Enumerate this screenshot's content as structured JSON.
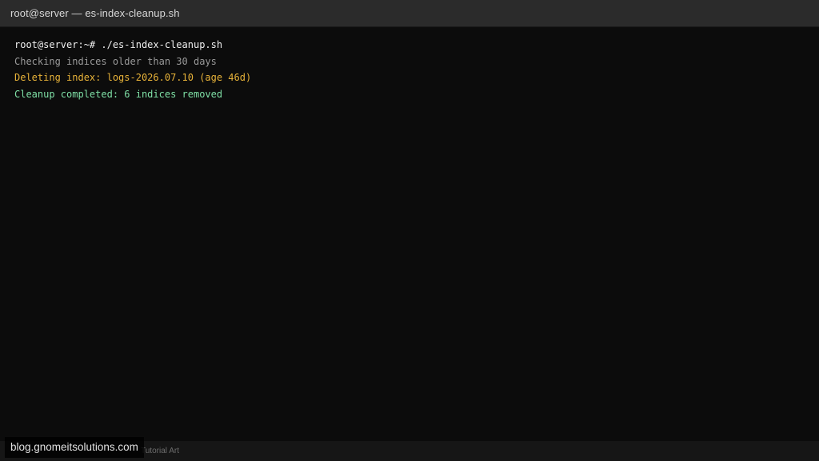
{
  "window": {
    "title": "root@server — es-index-cleanup.sh"
  },
  "terminal": {
    "lines": [
      {
        "text": "root@server:~# ./es-index-cleanup.sh",
        "color": "#f0f0f0"
      },
      {
        "text": "Checking indices older than 30 days",
        "color": "#9a9a9a"
      },
      {
        "text": "Deleting index: logs-2026.07.10 (age 46d)",
        "color": "#e8b339"
      },
      {
        "text": "Cleanup completed: 6 indices removed",
        "color": "#7fe0a6"
      }
    ]
  },
  "footer": {
    "caption": "Tutorial Art"
  },
  "watermark": {
    "text": "blog.gnomeitsolutions.com"
  }
}
